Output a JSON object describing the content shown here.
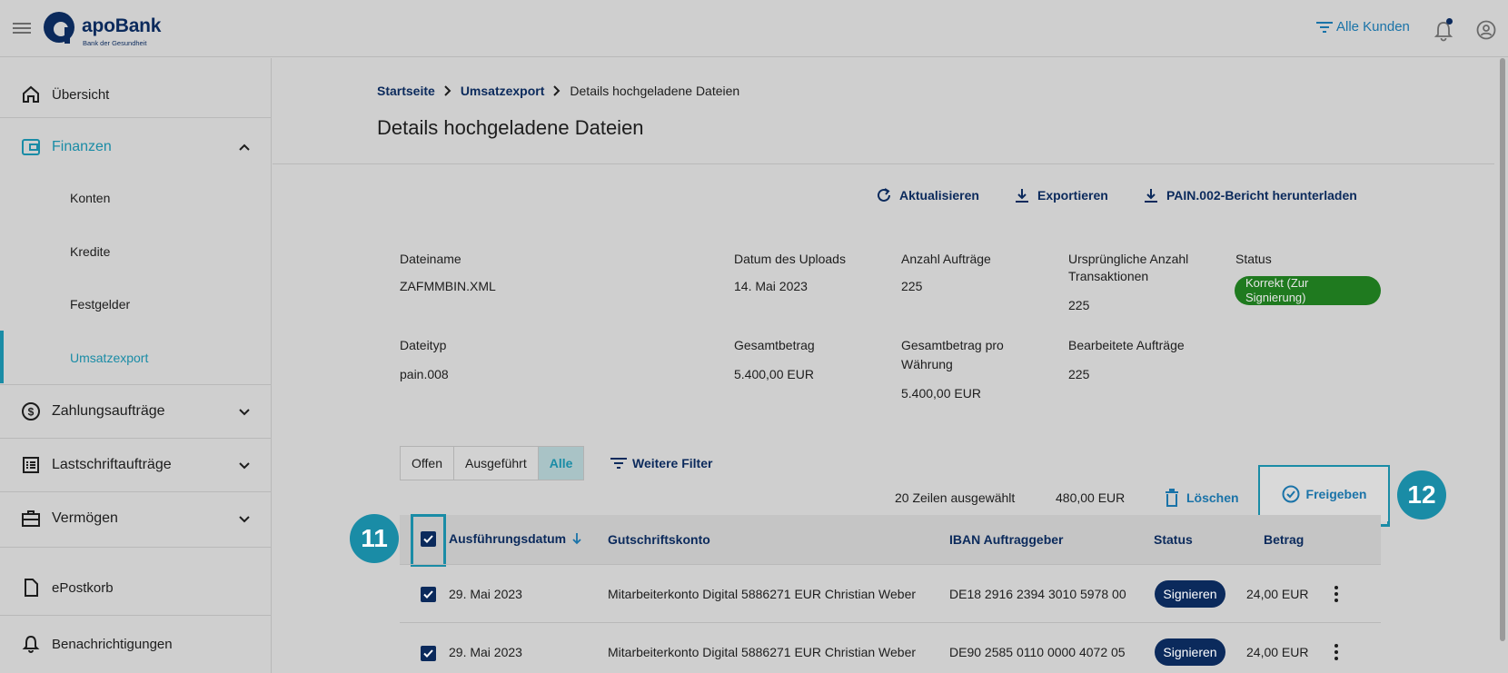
{
  "header": {
    "brand": "apoBank",
    "brand_sub": "Bank der Gesundheit",
    "customer_filter": "Alle Kunden"
  },
  "sidebar": {
    "items": [
      {
        "label": "Übersicht",
        "icon": "home-icon"
      },
      {
        "label": "Finanzen",
        "icon": "wallet-icon"
      },
      {
        "label": "Zahlungsaufträge",
        "icon": "dollar-icon"
      },
      {
        "label": "Lastschriftaufträge",
        "icon": "list-icon"
      },
      {
        "label": "Vermögen",
        "icon": "briefcase-icon"
      },
      {
        "label": "ePostkorb",
        "icon": "document-icon"
      },
      {
        "label": "Benachrichtigungen",
        "icon": "bell-icon"
      }
    ],
    "finanzen_sub": [
      "Konten",
      "Kredite",
      "Festgelder",
      "Umsatzexport"
    ],
    "active_sub": "Umsatzexport"
  },
  "breadcrumb": {
    "items": [
      "Startseite",
      "Umsatzexport",
      "Details hochgeladene Dateien"
    ]
  },
  "page": {
    "title": "Details hochgeladene Dateien"
  },
  "actions": {
    "refresh": "Aktualisieren",
    "export": "Exportieren",
    "pain_report": "PAIN.002-Bericht herunterladen"
  },
  "details": {
    "dateiname_label": "Dateiname",
    "dateiname_value": "ZAFMMBIN.XML",
    "datum_label": "Datum des Uploads",
    "datum_value": "14. Mai 2023",
    "anzahl_label": "Anzahl Aufträge",
    "anzahl_value": "225",
    "urspr_label_1": "Ursprüngliche Anzahl",
    "urspr_label_2": "Transaktionen",
    "urspr_value": "225",
    "status_label": "Status",
    "status_value": "Korrekt (Zur Signierung)",
    "dateityp_label": "Dateityp",
    "dateityp_value": "pain.008",
    "gesamt_label": "Gesamtbetrag",
    "gesamt_value": "5.400,00 EUR",
    "gesamt_pw_label_1": "Gesamtbetrag pro",
    "gesamt_pw_label_2": "Währung",
    "gesamt_pw_value": "5.400,00 EUR",
    "bearb_label": "Bearbeitete Aufträge",
    "bearb_value": "225"
  },
  "filters": {
    "tabs": [
      "Offen",
      "Ausgeführt",
      "Alle"
    ],
    "selected": "Alle",
    "more": "Weitere Filter"
  },
  "selection": {
    "count": "20 Zeilen ausgewählt",
    "sum": "480,00 EUR",
    "delete": "Löschen",
    "approve": "Freigeben"
  },
  "badges": {
    "left": "11",
    "right": "12"
  },
  "table": {
    "columns": [
      "Ausführungsdatum",
      "Gutschriftskonto",
      "IBAN Auftraggeber",
      "Status",
      "Betrag"
    ],
    "rows": [
      {
        "date": "29. Mai 2023",
        "account": "Mitarbeiterkonto Digital 5886271 EUR Christian Weber",
        "iban": "DE18 2916 2394 3010 5978 00",
        "status": "Signieren",
        "amount": "24,00 EUR"
      },
      {
        "date": "29. Mai 2023",
        "account": "Mitarbeiterkonto Digital 5886271 EUR Christian Weber",
        "iban": "DE90 2585 0110 0000 4072 05",
        "status": "Signieren",
        "amount": "24,00 EUR"
      }
    ]
  },
  "colors": {
    "navy": "#0b2a5c",
    "teal": "#1a8ca6",
    "link_blue": "#1a73a8",
    "status_green": "#1f7a1f"
  }
}
